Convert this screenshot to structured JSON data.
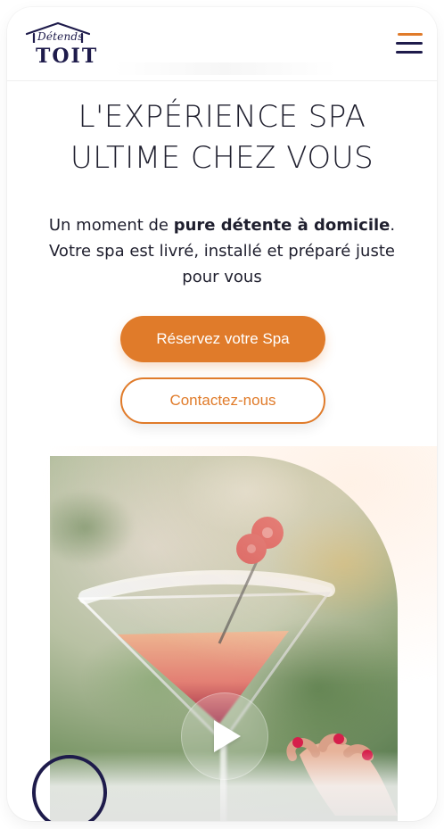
{
  "brand": {
    "script_text": "Détends",
    "main_text": "TOIT",
    "primary_color": "#1e1b4b",
    "accent_color": "#e07b2a"
  },
  "header": {
    "menu_icon": "hamburger-icon"
  },
  "hero": {
    "title_line_1": "L'EXPÉRIENCE SPA",
    "title_line_2": "ULTIME CHEZ VOUS",
    "subtitle_prefix": "Un moment de ",
    "subtitle_bold": "pure détente à domicile",
    "subtitle_suffix": ".",
    "subtitle_line_2": "Votre spa est livré, installé et préparé juste",
    "subtitle_line_3": "pour vous"
  },
  "actions": {
    "primary_label": "Réservez votre Spa",
    "secondary_label": "Contactez-nous"
  },
  "media": {
    "play_icon": "play-icon"
  },
  "widgets": {
    "chat_icon": "chat-bubble-icon"
  }
}
